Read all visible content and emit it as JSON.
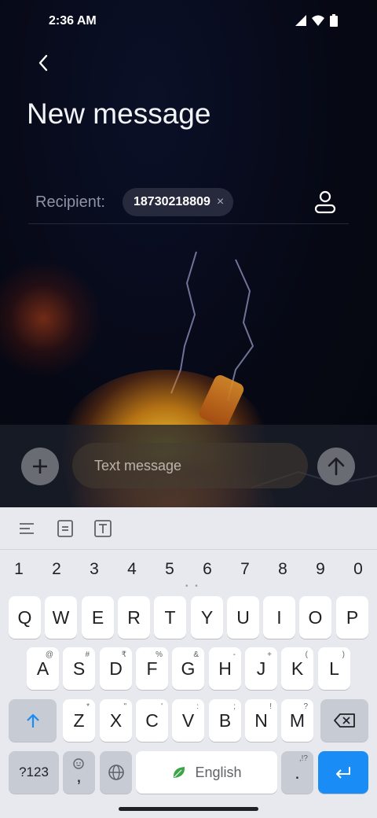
{
  "status": {
    "time": "2:36 AM"
  },
  "header": {
    "title": "New message"
  },
  "recipient": {
    "label": "Recipient:",
    "chip_number": "18730218809",
    "chip_remove": "×"
  },
  "compose": {
    "placeholder": "Text message"
  },
  "keyboard": {
    "numbers": [
      "1",
      "2",
      "3",
      "4",
      "5",
      "6",
      "7",
      "8",
      "9",
      "0"
    ],
    "row1": [
      "Q",
      "W",
      "E",
      "R",
      "T",
      "Y",
      "U",
      "I",
      "O",
      "P"
    ],
    "row2": [
      {
        "k": "A",
        "h": "@"
      },
      {
        "k": "S",
        "h": "#"
      },
      {
        "k": "D",
        "h": "₹"
      },
      {
        "k": "F",
        "h": "%"
      },
      {
        "k": "G",
        "h": "&"
      },
      {
        "k": "H",
        "h": "-"
      },
      {
        "k": "J",
        "h": "+"
      },
      {
        "k": "K",
        "h": "("
      },
      {
        "k": "L",
        "h": ")"
      }
    ],
    "row3": [
      {
        "k": "Z",
        "h": "*"
      },
      {
        "k": "X",
        "h": "\""
      },
      {
        "k": "C",
        "h": "'"
      },
      {
        "k": "V",
        "h": ":"
      },
      {
        "k": "B",
        "h": ";"
      },
      {
        "k": "N",
        "h": "!"
      },
      {
        "k": "M",
        "h": "?"
      }
    ],
    "symbols_key": "?123",
    "comma_key": ",",
    "space_label": "English",
    "period_key": ".",
    "period_hint": ",!?"
  },
  "colors": {
    "accent": "#1a8cf5",
    "background": "#070a17",
    "keyboard": "#e7e9ee"
  }
}
